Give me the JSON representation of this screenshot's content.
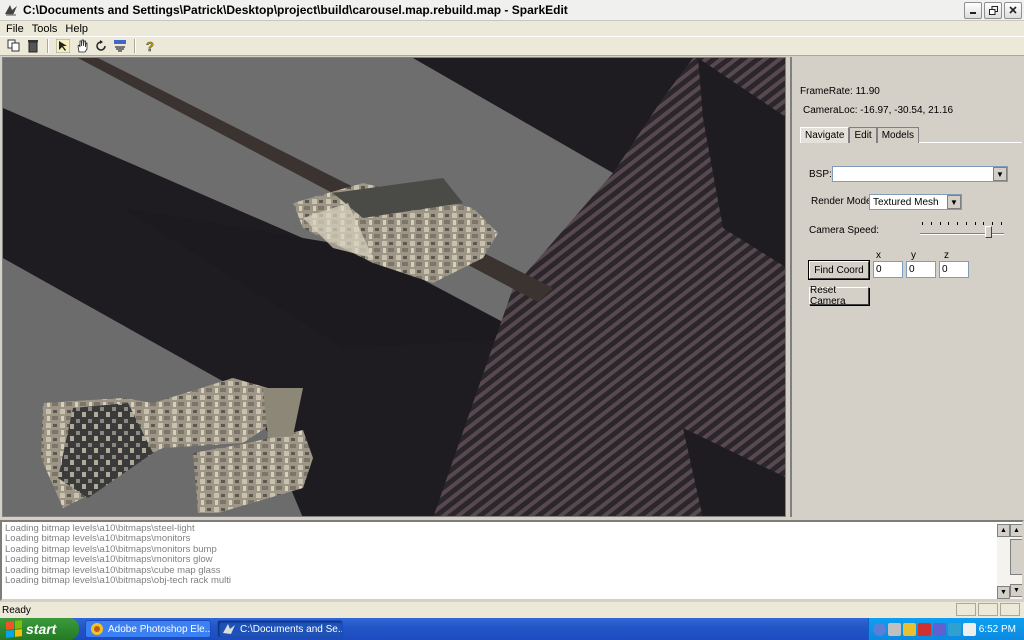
{
  "window": {
    "title": "C:\\Documents and Settings\\Patrick\\Desktop\\project\\build\\carousel.map.rebuild.map - SparkEdit"
  },
  "menu": [
    "File",
    "Tools",
    "Help"
  ],
  "toolbar": {
    "icons": [
      "copy-icon",
      "delete-icon",
      "select-icon",
      "hand-pan-icon",
      "rotate-icon",
      "info-icon",
      "help-icon"
    ]
  },
  "panel": {
    "framerate": "FrameRate: 11.90",
    "cameraloc": "CameraLoc: -16.97, -30.54, 21.16",
    "tabs": [
      "Navigate",
      "Edit",
      "Models"
    ],
    "bsp_label": "BSP:",
    "bsp_value": "",
    "render_mode_label": "Render Mode:",
    "render_mode_value": "Textured Mesh",
    "camera_speed_label": "Camera Speed:",
    "camera_speed_level": 0.85,
    "axis_x": "x",
    "axis_y": "y",
    "axis_z": "z",
    "find_coord": "Find Coord",
    "coord_x": "0",
    "coord_y": "0",
    "coord_z": "0",
    "reset_camera": "Reset Camera"
  },
  "log": [
    "Loading bitmap levels\\a10\\bitmaps\\steel-light",
    "Loading bitmap levels\\a10\\bitmaps\\monitors",
    "Loading bitmap levels\\a10\\bitmaps\\monitors bump",
    "Loading bitmap levels\\a10\\bitmaps\\monitors glow",
    "Loading bitmap levels\\a10\\bitmaps\\cube map glass",
    "Loading bitmap levels\\a10\\bitmaps\\obj-tech rack multi"
  ],
  "status": "Ready",
  "taskbar": {
    "start": "start",
    "tasks": [
      "Adobe Photoshop Ele...",
      "C:\\Documents and Se..."
    ],
    "clock": "6:52 PM"
  },
  "colors": {
    "viewport_dark": "#1e1c20",
    "viewport_floor": "#6f6f6f",
    "stripe": "#4a4046",
    "taskbar": "#2456c7",
    "start": "#2f8a2f"
  }
}
